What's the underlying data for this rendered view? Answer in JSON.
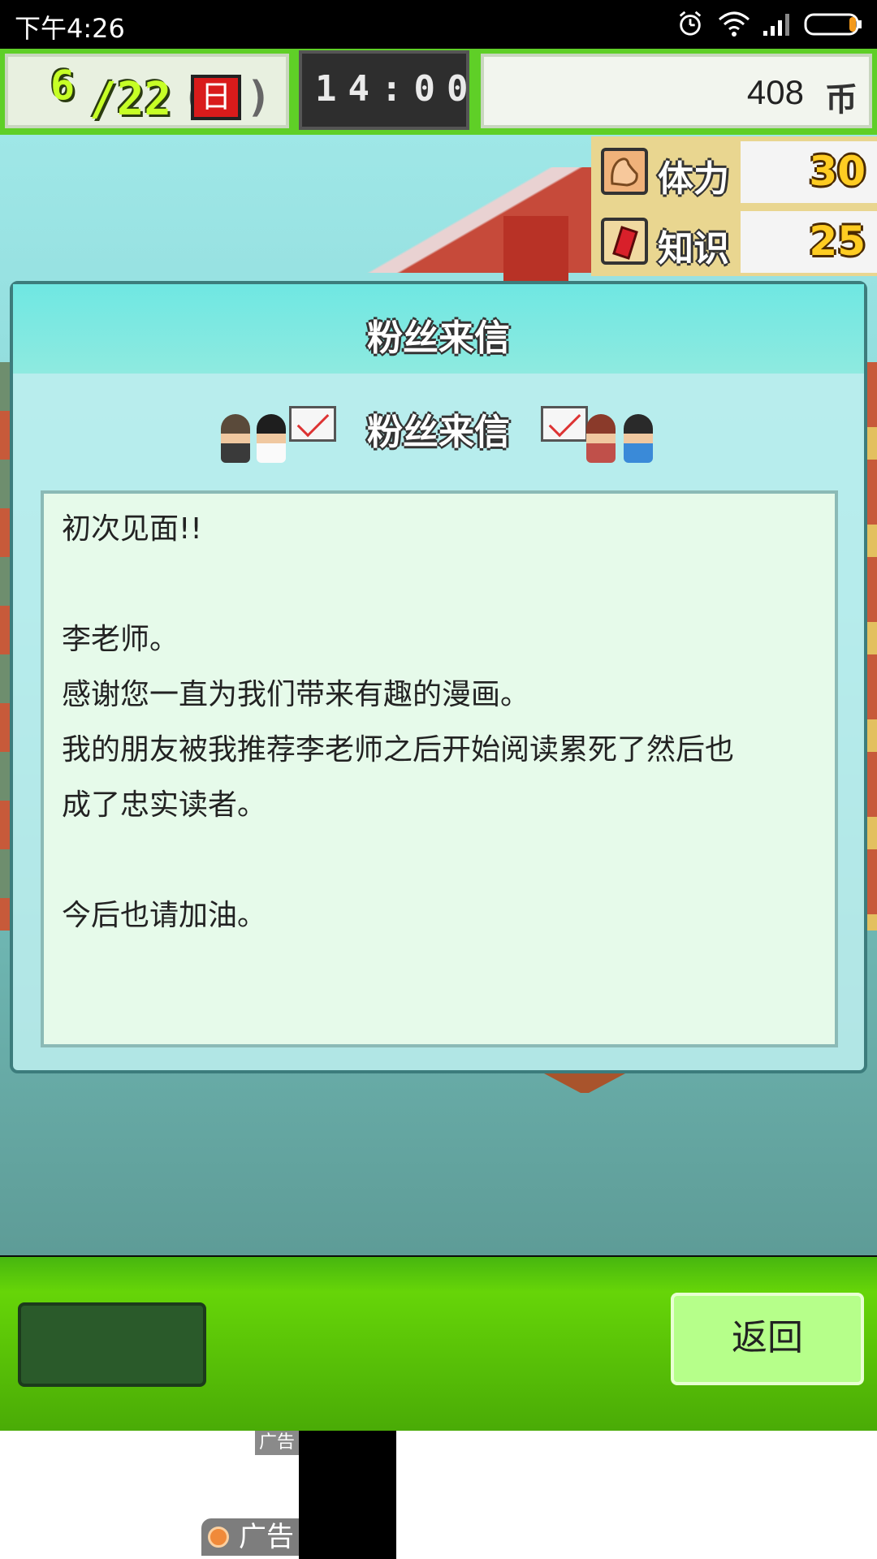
{
  "status_bar": {
    "time": "下午4:26",
    "icons": [
      "alarm-icon",
      "wifi-icon",
      "signal-icon",
      "battery-icon"
    ]
  },
  "top_bar": {
    "month": "6",
    "day": "/22",
    "weekday": "日",
    "clock": "14:00",
    "coins": "408",
    "coin_unit": "币"
  },
  "stats": [
    {
      "icon": "muscle-arm-icon",
      "label": "体力",
      "value": "30"
    },
    {
      "icon": "red-book-icon",
      "label": "知识",
      "value": "25"
    }
  ],
  "dialog": {
    "title": "粉丝来信",
    "banner_title": "粉丝来信",
    "letter_lines": [
      "初次见面!!",
      "",
      "李老师。",
      "感谢您一直为我们带来有趣的漫画。",
      "我的朋友被我推荐李老师之后开始阅读累死了然后也",
      "成了忠实读者。",
      "",
      "今后也请加油。"
    ]
  },
  "bottom_bar": {
    "back_label": "返回"
  },
  "ad": {
    "tag": "广告",
    "tag2": "广告"
  },
  "colors": {
    "accent_green": "#66d508",
    "dialog_teal": "#6fe7e2",
    "letter_bg": "#e6faea",
    "weekday_red": "#d91b1b"
  }
}
